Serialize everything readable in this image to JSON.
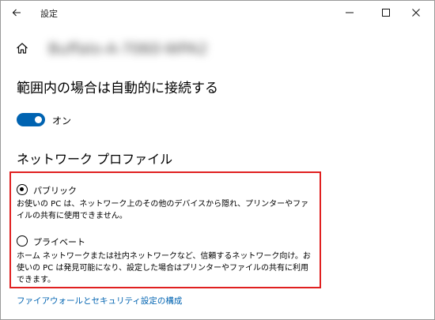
{
  "window": {
    "title": "設定",
    "icons": {
      "back": "arrow-left-icon",
      "minimize": "minimize-icon",
      "maximize": "maximize-icon",
      "close": "close-icon"
    }
  },
  "header": {
    "home_icon": "home-icon",
    "network_name": "Buffalo-A-7060-WPA2"
  },
  "auto_connect": {
    "title": "範囲内の場合は自動的に接続する",
    "toggle_state": "on",
    "toggle_label": "オン",
    "accent_color": "#0063b1"
  },
  "network_profile": {
    "title": "ネットワーク プロファイル",
    "highlight_color": "#e02020",
    "options": [
      {
        "label": "パブリック",
        "selected": true,
        "description": "お使いの PC は、ネットワーク上のその他のデバイスから隠れ、プリンターやファイルの共有に使用できません。"
      },
      {
        "label": "プライベート",
        "selected": false,
        "description": "ホーム ネットワークまたは社内ネットワークなど、信頼するネットワーク向け。お使いの PC は発見可能になり、設定した場合はプリンターやファイルの共有に利用できます。"
      }
    ]
  },
  "links": {
    "firewall": "ファイアウォールとセキュリティ設定の構成"
  }
}
